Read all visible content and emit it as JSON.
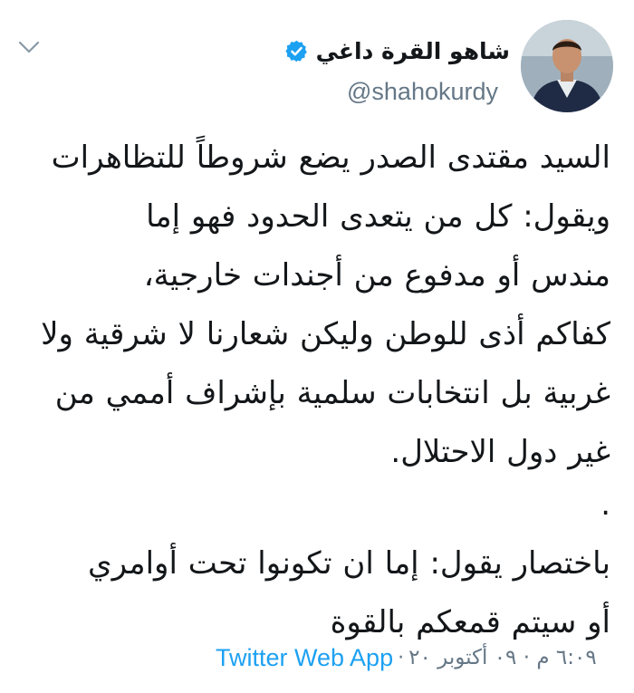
{
  "author": {
    "display_name": "شاهو القرة داغي",
    "handle": "@shahokurdy",
    "verified_icon": "verified-badge-icon",
    "avatar_icon": "profile-avatar"
  },
  "menu_icon": "chevron-down-icon",
  "tweet": {
    "lines": [
      "السيد مقتدى الصدر يضع شروطاً للتظاهرات",
      "ويقول: كل من يتعدى الحدود فهو إما",
      "مندس أو مدفوع من أجندات خارجية،",
      "كفاكم أذى للوطن وليكن شعارنا لا شرقية ولا",
      "غربية بل انتخابات سلمية بإشراف أممي من",
      "غير دول الاحتلال.",
      ".",
      "باختصار يقول: إما ان تكونوا تحت أوامري",
      "أو سيتم قمعكم بالقوة"
    ]
  },
  "meta": {
    "timestamp": "٦:٠٩ م · ٠٩ أكتوبر ٢٠",
    "separator": "·",
    "source": "Twitter Web App"
  },
  "colors": {
    "link": "#1da1f2",
    "secondary": "#657786",
    "text": "#14171a"
  }
}
